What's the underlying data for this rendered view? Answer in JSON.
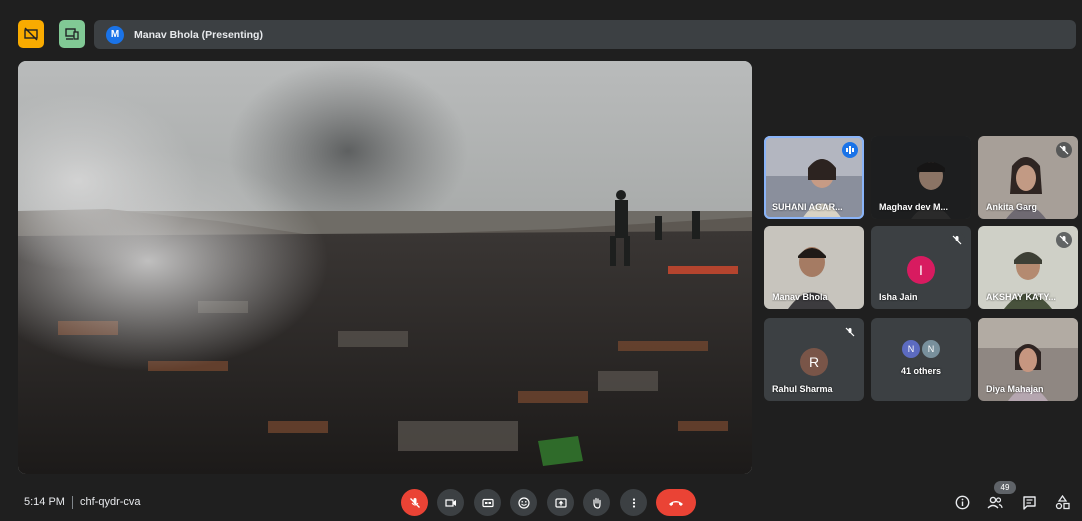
{
  "presenter": {
    "avatar_letter": "M",
    "label": "Manav Bhola (Presenting)"
  },
  "tiles": [
    {
      "name": "SUHANI AGAR...",
      "state": "speaking"
    },
    {
      "name": "Maghav dev M...",
      "state": "normal"
    },
    {
      "name": "Ankita Garg",
      "state": "muted"
    },
    {
      "name": "Manav Bhola",
      "state": "normal"
    },
    {
      "name": "Isha Jain",
      "state": "muted",
      "avatar_letter": "I",
      "avatar_color": "#d81b60"
    },
    {
      "name": "AKSHAY KATY...",
      "state": "muted"
    },
    {
      "name": "Rahul Sharma",
      "state": "muted",
      "avatar_letter": "R",
      "avatar_color": "#795548"
    },
    {
      "name": "41 others",
      "state": "group",
      "mini_avatars": [
        "N",
        "N"
      ]
    },
    {
      "name": "Diya Mahajan",
      "state": "normal"
    }
  ],
  "bottom": {
    "time": "5:14 PM",
    "meeting_code": "chf-qydr-cva",
    "participants_count": "49"
  },
  "colors": {
    "accent": "#1a73e8",
    "danger": "#ea4335",
    "bg": "#1f1f1f",
    "tile": "#3c4043"
  }
}
